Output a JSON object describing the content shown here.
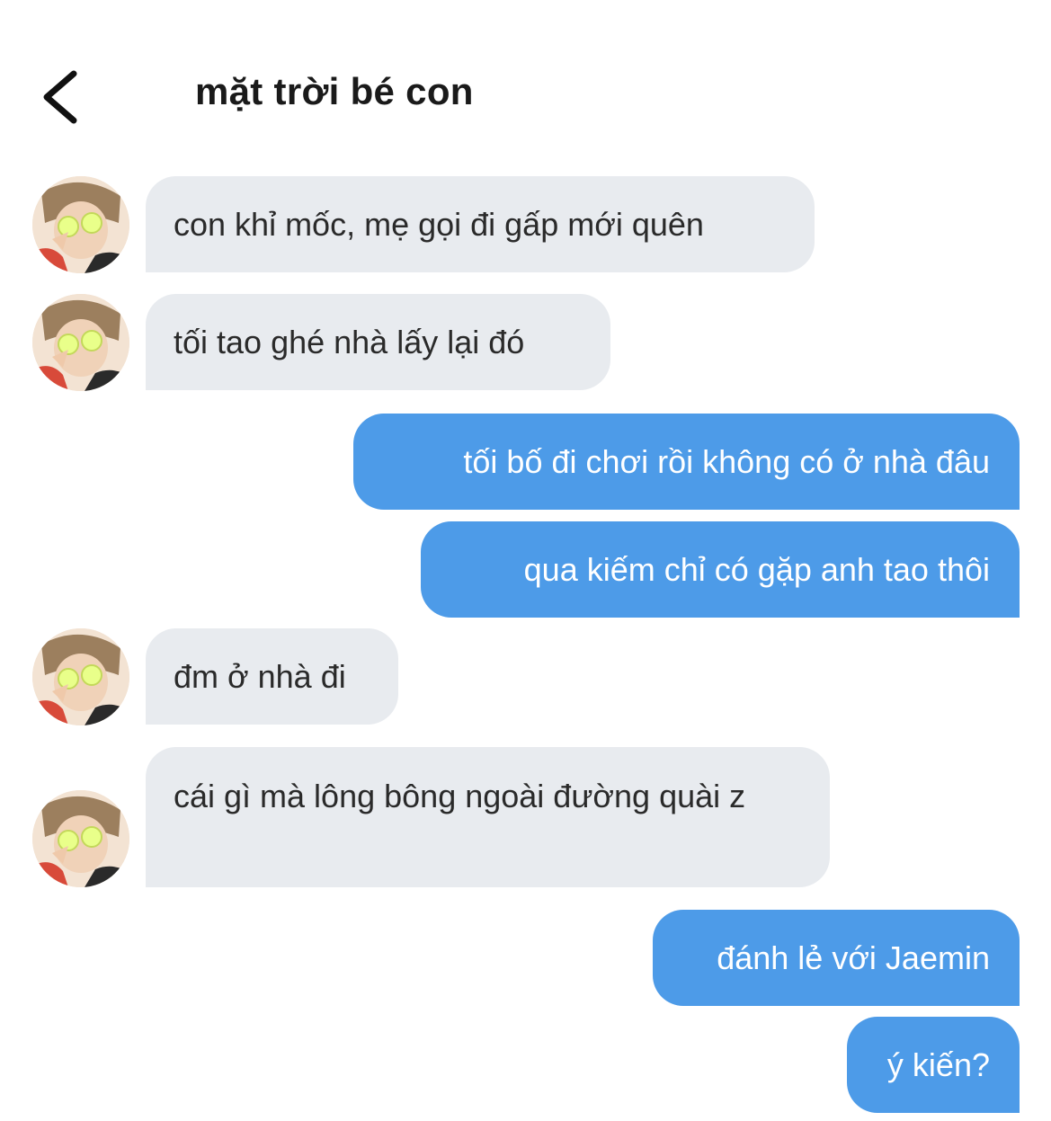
{
  "header": {
    "back_icon": "chevron-left-icon",
    "title": "mặt trời bé con"
  },
  "messages": [
    {
      "side": "incoming",
      "text": "con khỉ mốc, mẹ gọi đi gấp mới quên"
    },
    {
      "side": "incoming",
      "text": "tối tao ghé nhà lấy lại đó"
    },
    {
      "side": "outgoing",
      "text": "tối bố đi chơi rồi không có ở nhà đâu"
    },
    {
      "side": "outgoing",
      "text": "qua kiếm chỉ có gặp anh tao thôi"
    },
    {
      "side": "incoming",
      "text": "đm ở nhà đi"
    },
    {
      "side": "incoming",
      "text": "cái gì mà lông bông ngoài đường quài z"
    },
    {
      "side": "outgoing",
      "text": "đánh lẻ với Jaemin"
    },
    {
      "side": "outgoing",
      "text": "ý kiến?"
    }
  ],
  "colors": {
    "incoming_bubble": "#e8ebef",
    "outgoing_bubble": "#4d9be8",
    "outgoing_text": "#ffffff",
    "title_text": "#1a1a1a"
  }
}
